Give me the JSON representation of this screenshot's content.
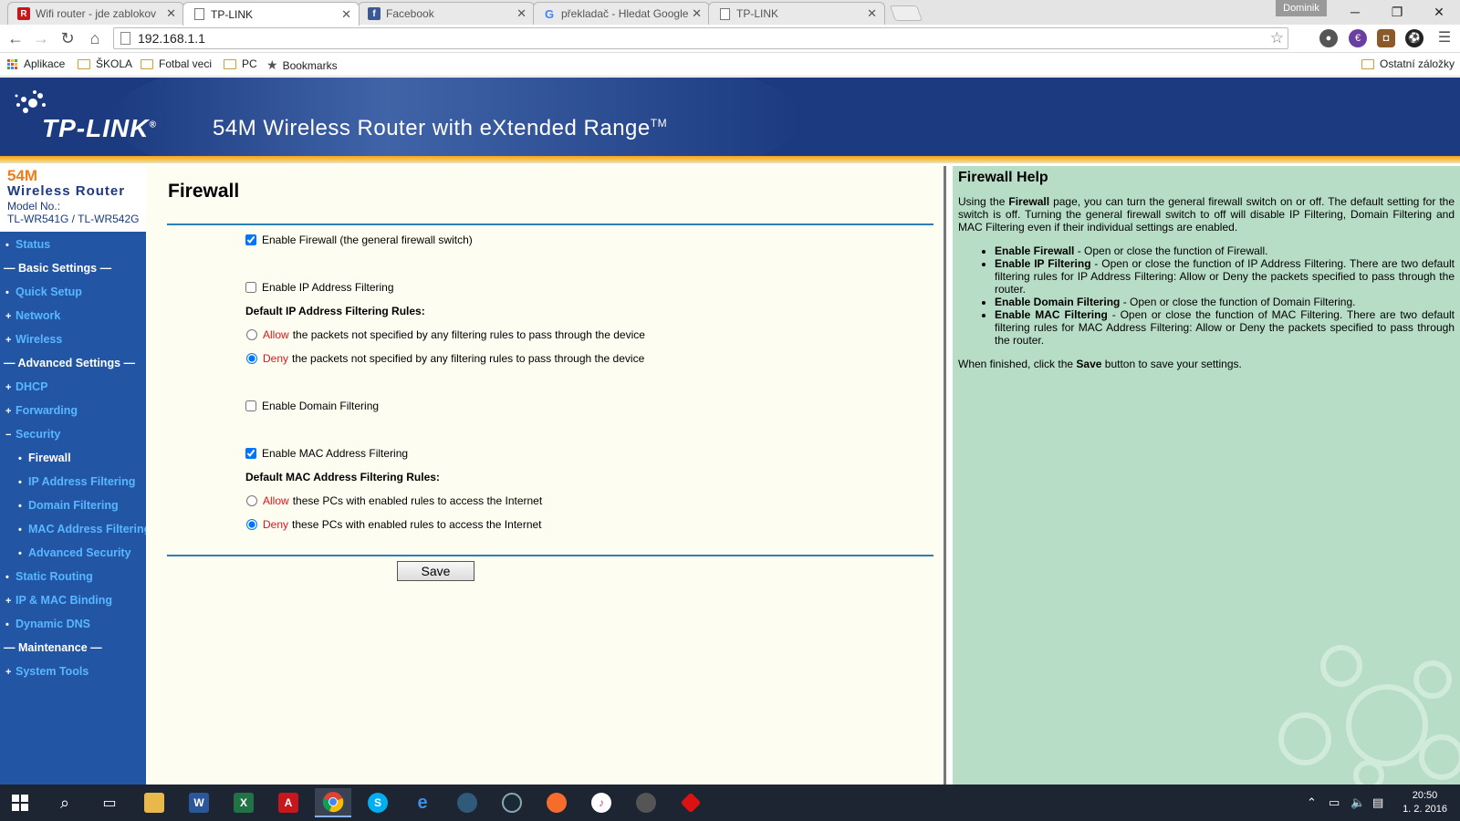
{
  "browser": {
    "tabs": [
      {
        "label": "Wifi router - jde zablokov",
        "icon": "acrobat-icon",
        "active": false
      },
      {
        "label": "TP-LINK",
        "icon": "page-icon",
        "active": true
      },
      {
        "label": "Facebook",
        "icon": "facebook-icon",
        "active": false
      },
      {
        "label": "překladač - Hledat Google",
        "icon": "google-icon",
        "active": false
      },
      {
        "label": "TP-LINK",
        "icon": "page-icon",
        "active": false
      }
    ],
    "profile_name": "Dominik",
    "url": "192.168.1.1",
    "bookmarks": [
      {
        "label": "Aplikace",
        "icon": "apps-icon"
      },
      {
        "label": "ŠKOLA",
        "icon": "folder-icon"
      },
      {
        "label": "Fotbal veci",
        "icon": "folder-icon"
      },
      {
        "label": "PC",
        "icon": "folder-icon"
      },
      {
        "label": "Bookmarks",
        "icon": "star-icon"
      }
    ],
    "other_bookmarks": "Ostatní záložky"
  },
  "banner": {
    "logo": "TP-LINK",
    "logo_mark": "®",
    "product": "54M Wireless Router with eXtended Range",
    "product_tm": "TM"
  },
  "sidebar": {
    "model_54m": "54M",
    "model_title": "Wireless  Router",
    "model_no_label": "Model No.:",
    "model_no": "TL-WR541G / TL-WR542G",
    "items": [
      {
        "label": "Status",
        "type": "item"
      },
      {
        "label": "— Basic Settings —",
        "type": "head"
      },
      {
        "label": "Quick Setup",
        "type": "item"
      },
      {
        "label": "Network",
        "type": "plus"
      },
      {
        "label": "Wireless",
        "type": "plus"
      },
      {
        "label": "— Advanced Settings —",
        "type": "head"
      },
      {
        "label": "DHCP",
        "type": "plus"
      },
      {
        "label": "Forwarding",
        "type": "plus"
      },
      {
        "label": "Security",
        "type": "minus"
      },
      {
        "label": "Firewall",
        "type": "sub-current"
      },
      {
        "label": "IP Address Filtering",
        "type": "sub"
      },
      {
        "label": "Domain Filtering",
        "type": "sub"
      },
      {
        "label": "MAC Address Filtering",
        "type": "sub"
      },
      {
        "label": "Advanced Security",
        "type": "sub"
      },
      {
        "label": "Static Routing",
        "type": "item"
      },
      {
        "label": "IP & MAC Binding",
        "type": "plus"
      },
      {
        "label": "Dynamic DNS",
        "type": "item"
      },
      {
        "label": "— Maintenance —",
        "type": "head"
      },
      {
        "label": "System Tools",
        "type": "plus"
      }
    ]
  },
  "main": {
    "title": "Firewall",
    "enable_firewall": "Enable Firewall (the general firewall switch)",
    "enable_firewall_checked": true,
    "enable_ip": "Enable IP Address Filtering",
    "enable_ip_checked": false,
    "ip_rules_label": "Default IP Address Filtering Rules:",
    "ip_allow_word": "Allow",
    "ip_allow_text": "the packets not specified by any filtering rules to pass through the device",
    "ip_deny_word": "Deny",
    "ip_deny_text": "the packets not specified by any filtering rules to pass through the device",
    "ip_selected": "deny",
    "enable_domain": "Enable Domain Filtering",
    "enable_domain_checked": false,
    "enable_mac": "Enable MAC Address Filtering",
    "enable_mac_checked": true,
    "mac_rules_label": "Default MAC Address Filtering Rules:",
    "mac_allow_word": "Allow",
    "mac_allow_text": "these PCs with enabled rules to access the Internet",
    "mac_deny_word": "Deny",
    "mac_deny_text": "these PCs with enabled rules to access the Internet",
    "mac_selected": "deny",
    "save_label": "Save"
  },
  "help": {
    "title": "Firewall Help",
    "intro_1": "Using the ",
    "intro_b": "Firewall",
    "intro_2": " page, you can turn the general firewall switch on or off. The default setting for the switch is off. Turning the general firewall switch to off will disable IP Filtering, Domain Filtering and MAC Filtering even if their individual settings are enabled.",
    "items": [
      {
        "term": "Enable Firewall",
        "desc": " - Open or close the function of Firewall."
      },
      {
        "term": "Enable IP Filtering",
        "desc": " - Open or close the function of IP Address Filtering. There are two default filtering rules for IP Address Filtering: Allow or Deny the packets specified to pass through the router."
      },
      {
        "term": "Enable Domain Filtering",
        "desc": " - Open or close the function of Domain Filtering."
      },
      {
        "term": "Enable MAC Filtering",
        "desc": " - Open or close the function of MAC Filtering. There are two default filtering rules for MAC Address Filtering: Allow or Deny the packets specified to pass through the router."
      }
    ],
    "finish_1": "When finished, click the ",
    "finish_b": "Save",
    "finish_2": " button to save your settings."
  },
  "taskbar": {
    "time": "20:50",
    "date": "1. 2. 2016",
    "apps": [
      "start-icon",
      "search-icon",
      "task-view-icon",
      "file-explorer-icon",
      "word-icon",
      "excel-icon",
      "acrobat-icon",
      "chrome-icon",
      "skype-icon",
      "edge-icon",
      "steelseries-icon",
      "steam-icon",
      "origin-icon",
      "itunes-icon",
      "app-icon",
      "antivirus-icon"
    ]
  },
  "colors": {
    "banner_bg": "#1b3a80",
    "sidebar_bg": "#2255a4",
    "nav_link": "#58b7ff",
    "main_bg": "#fefdf1",
    "help_bg": "#b8ddc6",
    "rule_line": "#2a7fb8",
    "allow_deny_red": "#e0161b"
  }
}
